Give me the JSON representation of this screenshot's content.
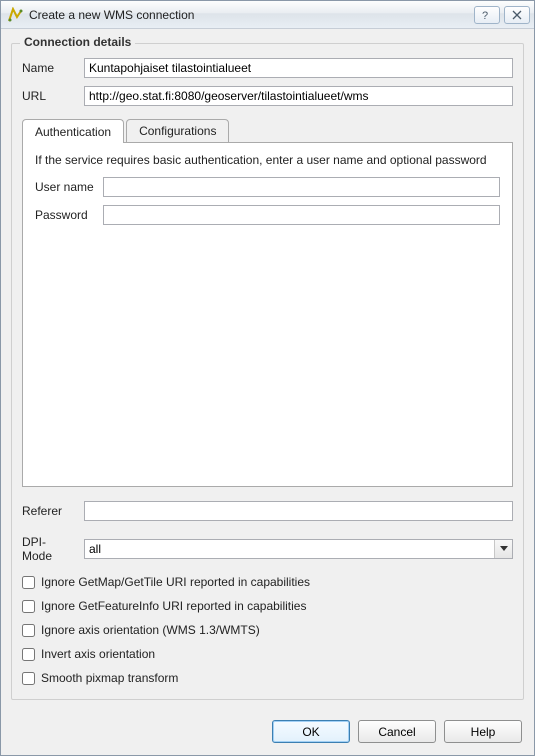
{
  "titlebar": {
    "title": "Create a new WMS connection"
  },
  "group": {
    "title": "Connection details"
  },
  "fields": {
    "name_label": "Name",
    "name_value": "Kuntapohjaiset tilastointialueet",
    "url_label": "URL",
    "url_value": "http://geo.stat.fi:8080/geoserver/tilastointialueet/wms"
  },
  "tabs": {
    "auth_label": "Authentication",
    "config_label": "Configurations"
  },
  "auth": {
    "description": "If the service requires basic authentication, enter a user name and optional password",
    "username_label": "User name",
    "username_value": "",
    "password_label": "Password",
    "password_value": ""
  },
  "referer": {
    "label": "Referer",
    "value": ""
  },
  "dpi": {
    "label": "DPI-Mode",
    "selected": "all"
  },
  "checks": {
    "c1": "Ignore GetMap/GetTile URI reported in capabilities",
    "c2": "Ignore GetFeatureInfo URI reported in capabilities",
    "c3": "Ignore axis orientation (WMS 1.3/WMTS)",
    "c4": "Invert axis orientation",
    "c5": "Smooth pixmap transform"
  },
  "buttons": {
    "ok": "OK",
    "cancel": "Cancel",
    "help": "Help"
  }
}
